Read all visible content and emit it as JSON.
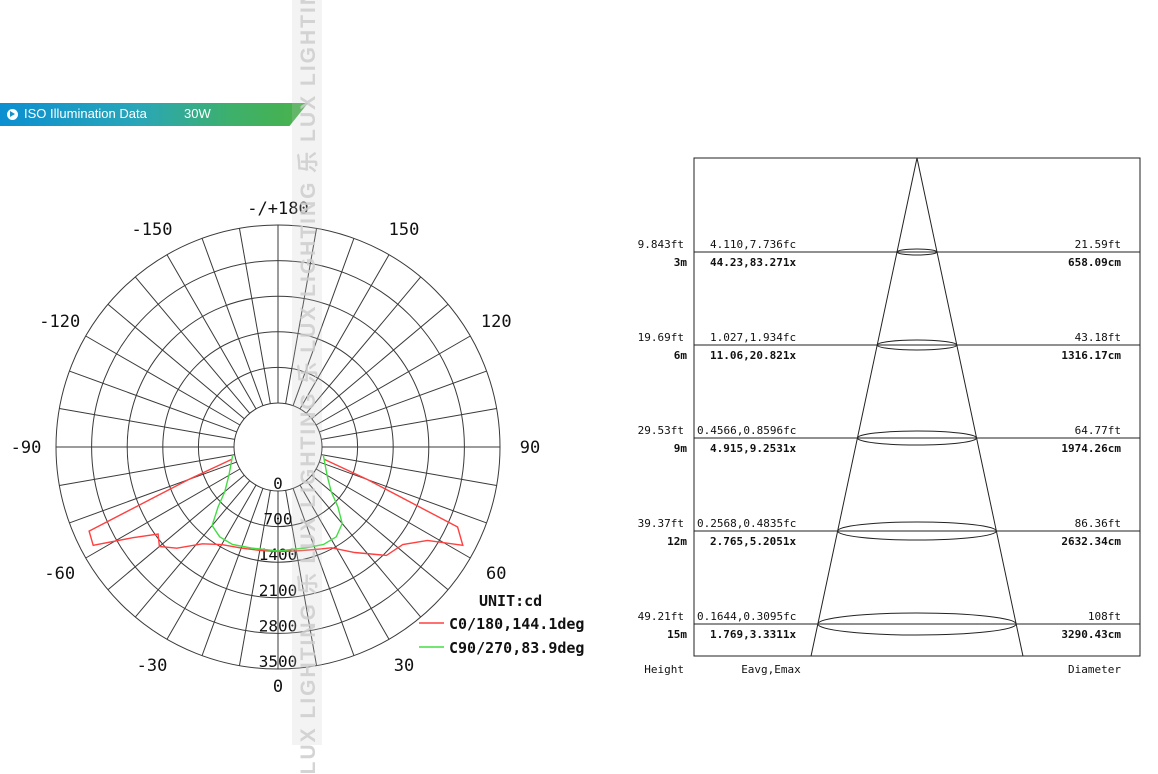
{
  "header": {
    "title": "ISO Illumination  Data",
    "power": "30W"
  },
  "watermark": {
    "text": "LUX LIGHTING  乐  LUX LIGHTING  乐  LUX LIGHTING  乐  LUX LIGHTING"
  },
  "chart_data": [
    {
      "type": "polar",
      "title": "",
      "unit_label": "UNIT:cd",
      "angle_labels": [
        {
          "text": "-/+180",
          "deg": 180
        },
        {
          "text": "150",
          "deg": 150
        },
        {
          "text": "-150",
          "deg": -150
        },
        {
          "text": "120",
          "deg": 120
        },
        {
          "text": "-120",
          "deg": -120
        },
        {
          "text": "90",
          "deg": 90
        },
        {
          "text": "-90",
          "deg": -90
        },
        {
          "text": "60",
          "deg": 60
        },
        {
          "text": "-60",
          "deg": -60
        },
        {
          "text": "30",
          "deg": 30
        },
        {
          "text": "-30",
          "deg": -30
        },
        {
          "text": "0",
          "deg": 0
        }
      ],
      "radial_ticks": [
        "0",
        "700",
        "1400",
        "2100",
        "2800",
        "3500"
      ],
      "radial_max": 3500,
      "series": [
        {
          "name": "C0/180,144.1deg",
          "color": "#ff4040",
          "points": [
            [
              -75,
              80
            ],
            [
              -70,
              1000
            ],
            [
              -66,
              3200
            ],
            [
              -62,
              3250
            ],
            [
              -58,
              2500
            ],
            [
              -54,
              2050
            ],
            [
              -50,
              2180
            ],
            [
              -45,
              1950
            ],
            [
              -38,
              1550
            ],
            [
              -30,
              1350
            ],
            [
              -20,
              1250
            ],
            [
              -10,
              1200
            ],
            [
              0,
              1190
            ],
            [
              10,
              1210
            ],
            [
              20,
              1280
            ],
            [
              28,
              1380
            ],
            [
              36,
              1700
            ],
            [
              45,
              2150
            ],
            [
              52,
              2250
            ],
            [
              58,
              2600
            ],
            [
              62,
              3250
            ],
            [
              66,
              3000
            ],
            [
              70,
              1000
            ],
            [
              75,
              80
            ]
          ]
        },
        {
          "name": "C90/270,83.9deg",
          "color": "#44dd44",
          "points": [
            [
              -80,
              40
            ],
            [
              -60,
              250
            ],
            [
              -50,
              500
            ],
            [
              -45,
              800
            ],
            [
              -40,
              1150
            ],
            [
              -33,
              1240
            ],
            [
              -25,
              1250
            ],
            [
              -15,
              1190
            ],
            [
              0,
              1180
            ],
            [
              15,
              1190
            ],
            [
              25,
              1250
            ],
            [
              33,
              1240
            ],
            [
              40,
              1100
            ],
            [
              45,
              800
            ],
            [
              50,
              500
            ],
            [
              60,
              250
            ],
            [
              80,
              40
            ]
          ]
        }
      ]
    },
    {
      "type": "table",
      "title": "",
      "columns": [
        "Height",
        "Eavg,Emax",
        "Diameter"
      ],
      "rows": [
        {
          "height_ft": "9.843ft",
          "height_m": "3m",
          "e_fc": "4.110,7.736fc",
          "e_lx": "44.23,83.271x",
          "d_ft": "21.59ft",
          "d_cm": "658.09cm"
        },
        {
          "height_ft": "19.69ft",
          "height_m": "6m",
          "e_fc": "1.027,1.934fc",
          "e_lx": "11.06,20.821x",
          "d_ft": "43.18ft",
          "d_cm": "1316.17cm"
        },
        {
          "height_ft": "29.53ft",
          "height_m": "9m",
          "e_fc": "0.4566,0.8596fc",
          "e_lx": "4.915,9.2531x",
          "d_ft": "64.77ft",
          "d_cm": "1974.26cm"
        },
        {
          "height_ft": "39.37ft",
          "height_m": "12m",
          "e_fc": "0.2568,0.4835fc",
          "e_lx": "2.765,5.2051x",
          "d_ft": "86.36ft",
          "d_cm": "2632.34cm"
        },
        {
          "height_ft": "49.21ft",
          "height_m": "15m",
          "e_fc": "0.1644,0.3095fc",
          "e_lx": "1.769,3.3311x",
          "d_ft": "108ft",
          "d_cm": "3290.43cm"
        }
      ],
      "beam_angle_deg": 144.1
    }
  ]
}
